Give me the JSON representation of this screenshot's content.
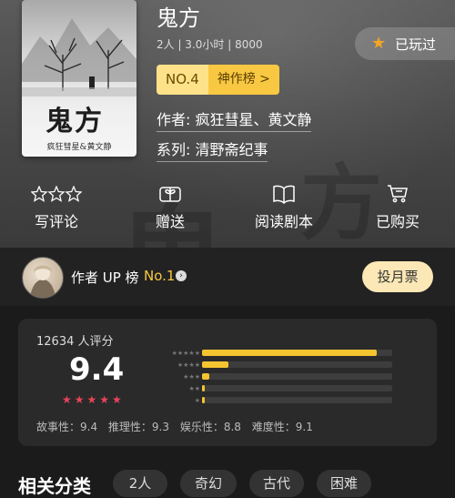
{
  "book": {
    "title": "鬼方",
    "meta": "2人 | 3.0小时 | 8000",
    "cover_title": "鬼方",
    "cover_author": "疯狂彗星&黄文静",
    "played_label": "已玩过",
    "rank_no": "NO.4",
    "rank_name": "神作榜 >",
    "author_line": "作者: 疯狂彗星、黄文静",
    "series_line": "系列: 清野斋纪事"
  },
  "actions": [
    {
      "label": "写评论",
      "icon": "stars-icon"
    },
    {
      "label": "赠送",
      "icon": "gift-icon"
    },
    {
      "label": "阅读剧本",
      "icon": "book-icon"
    },
    {
      "label": "已购买",
      "icon": "cart-icon"
    }
  ],
  "up": {
    "label": "作者 UP 榜",
    "rank": "No.1",
    "vote_button": "投月票"
  },
  "rating": {
    "count_text": "12634 人评分",
    "score": "9.4",
    "star_rows": [
      {
        "stars": "★★★★★",
        "fraction": 0.92
      },
      {
        "stars": "★★★★",
        "fraction": 0.14
      },
      {
        "stars": "★★★",
        "fraction": 0.04
      },
      {
        "stars": "★★",
        "fraction": 0.01
      },
      {
        "stars": "★",
        "fraction": 0.01
      }
    ],
    "subs": [
      "故事性：9.4",
      "推理性：9.3",
      "娱乐性：8.8",
      "难度性：9.1"
    ]
  },
  "related": {
    "title": "相关分类",
    "tags": [
      "2人",
      "奇幻",
      "古代",
      "困难"
    ]
  },
  "colors": {
    "accent": "#f9c842",
    "star_red": "#e8445a"
  }
}
